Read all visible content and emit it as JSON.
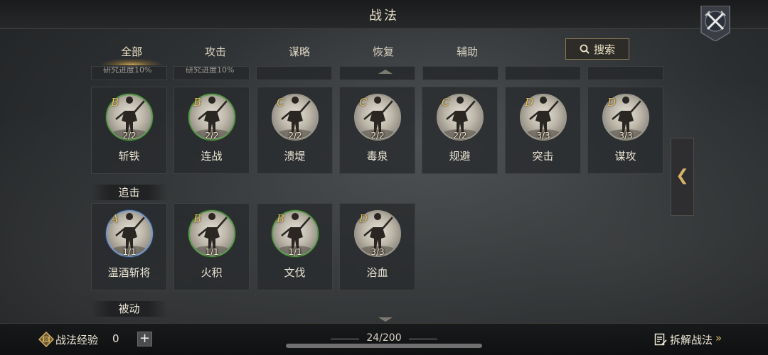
{
  "header": {
    "title": "战法"
  },
  "tabs": [
    {
      "label": "全部",
      "active": true
    },
    {
      "label": "攻击",
      "active": false
    },
    {
      "label": "谋略",
      "active": false
    },
    {
      "label": "恢复",
      "active": false
    },
    {
      "label": "辅助",
      "active": false
    }
  ],
  "search": {
    "label": "搜索"
  },
  "top_strip": [
    {
      "text": "研究进度10%"
    },
    {
      "text": "研究进度10%"
    },
    {
      "text": ""
    },
    {
      "text": ""
    },
    {
      "text": ""
    },
    {
      "text": ""
    },
    {
      "text": ""
    }
  ],
  "row1": [
    {
      "name": "斩铁",
      "grade": "B",
      "count": "2/2",
      "ring": "green"
    },
    {
      "name": "连战",
      "grade": "B",
      "count": "2/2",
      "ring": "green"
    },
    {
      "name": "溃堤",
      "grade": "C",
      "count": "2/2",
      "ring": "gray"
    },
    {
      "name": "毒泉",
      "grade": "C",
      "count": "2/2",
      "ring": "gray"
    },
    {
      "name": "规避",
      "grade": "C",
      "count": "2/2",
      "ring": "gray"
    },
    {
      "name": "突击",
      "grade": "D",
      "count": "3/3",
      "ring": "gray"
    },
    {
      "name": "谋攻",
      "grade": "D",
      "count": "3/3",
      "ring": "gray"
    }
  ],
  "sections": {
    "pursuit": "追击",
    "passive": "被动"
  },
  "row2": [
    {
      "name": "温酒斩将",
      "grade": "A",
      "count": "1/1",
      "ring": "blue"
    },
    {
      "name": "火积",
      "grade": "B",
      "count": "1/1",
      "ring": "green"
    },
    {
      "name": "文伐",
      "grade": "B",
      "count": "1/1",
      "ring": "green"
    },
    {
      "name": "浴血",
      "grade": "D",
      "count": "3/3",
      "ring": "gray"
    }
  ],
  "footer": {
    "exp_label": "战法经验",
    "exp_value": "0",
    "plus": "+",
    "capacity": "24/200",
    "decompose_label": "拆解战法",
    "decompose_chevron": "»"
  },
  "side": {
    "arrow": "❮"
  },
  "icons": [
    "crossed-swords-icon",
    "search-icon",
    "warrior-silhouette-icon",
    "exp-token-icon",
    "list-edit-icon",
    "chevron-left-icon"
  ],
  "colors": {
    "gold": "#d7b36a",
    "grade": "#e6c35c",
    "ring_green": "#5f9a52",
    "ring_blue": "#7a98c2"
  }
}
